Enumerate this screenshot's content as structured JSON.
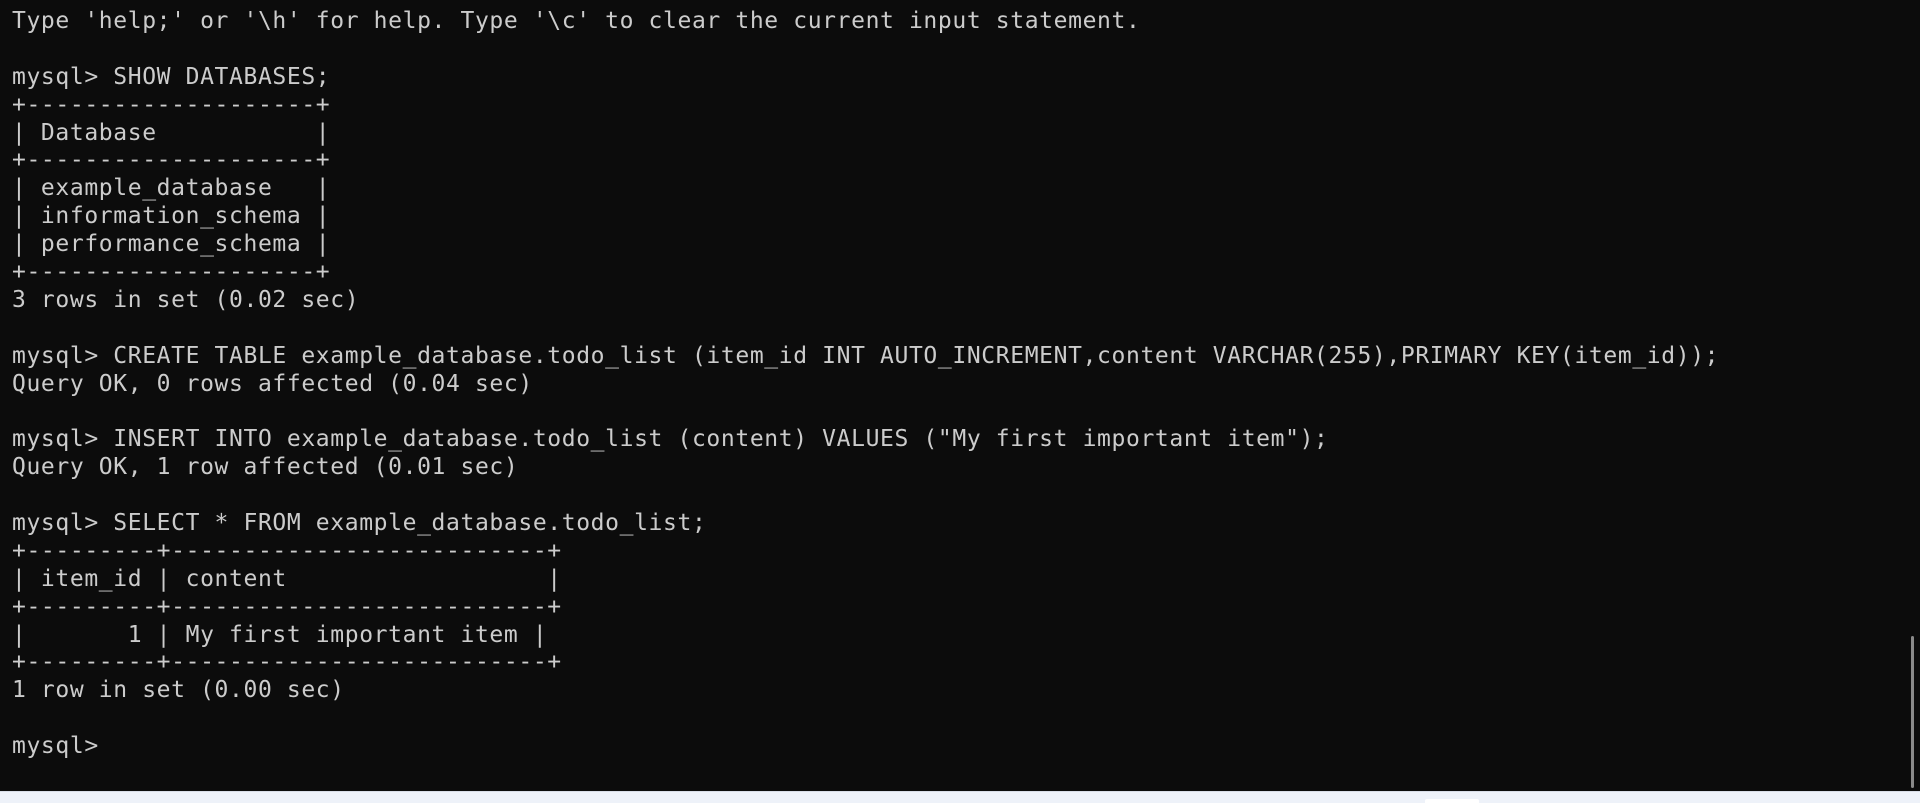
{
  "terminal": {
    "lines": [
      "Type 'help;' or '\\h' for help. Type '\\c' to clear the current input statement.",
      "",
      "mysql> SHOW DATABASES;",
      "+--------------------+",
      "| Database           |",
      "+--------------------+",
      "| example_database   |",
      "| information_schema |",
      "| performance_schema |",
      "+--------------------+",
      "3 rows in set (0.02 sec)",
      "",
      "mysql> CREATE TABLE example_database.todo_list (item_id INT AUTO_INCREMENT,content VARCHAR(255),PRIMARY KEY(item_id));",
      "Query OK, 0 rows affected (0.04 sec)",
      "",
      "mysql> INSERT INTO example_database.todo_list (content) VALUES (\"My first important item\");",
      "Query OK, 1 row affected (0.01 sec)",
      "",
      "mysql> SELECT * FROM example_database.todo_list;",
      "+---------+--------------------------+",
      "| item_id | content                  |",
      "+---------+--------------------------+",
      "|       1 | My first important item |",
      "+---------+--------------------------+",
      "1 row in set (0.00 sec)",
      "",
      "mysql> "
    ]
  },
  "colors": {
    "background": "#0c0c0c",
    "foreground": "#cccccc",
    "scrollbar_thumb": "#8a8a8a"
  }
}
